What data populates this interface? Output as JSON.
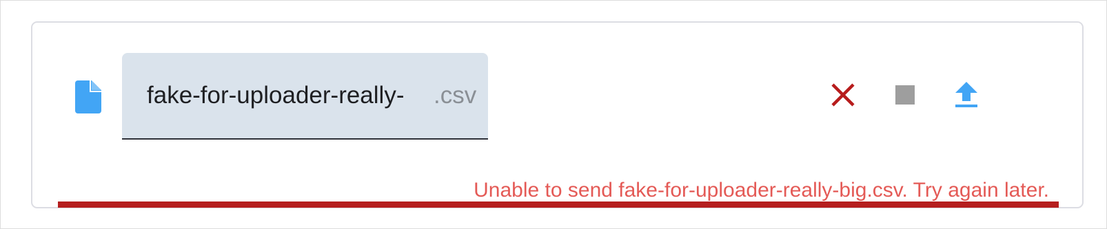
{
  "file": {
    "name": "fake-for-uploader-really-",
    "extension": ".csv",
    "icon": "file-icon"
  },
  "actions": {
    "cancel": {
      "icon": "close-icon",
      "color": "#b71c1c"
    },
    "stop": {
      "icon": "stop-icon",
      "color": "#9e9e9e"
    },
    "upload": {
      "icon": "upload-icon",
      "color": "#42a5f5"
    }
  },
  "error": {
    "message": "Unable to send fake-for-uploader-really-big.csv. Try again later."
  },
  "progress": {
    "value": 1.0,
    "status": "error",
    "color": "#b51f1f"
  }
}
